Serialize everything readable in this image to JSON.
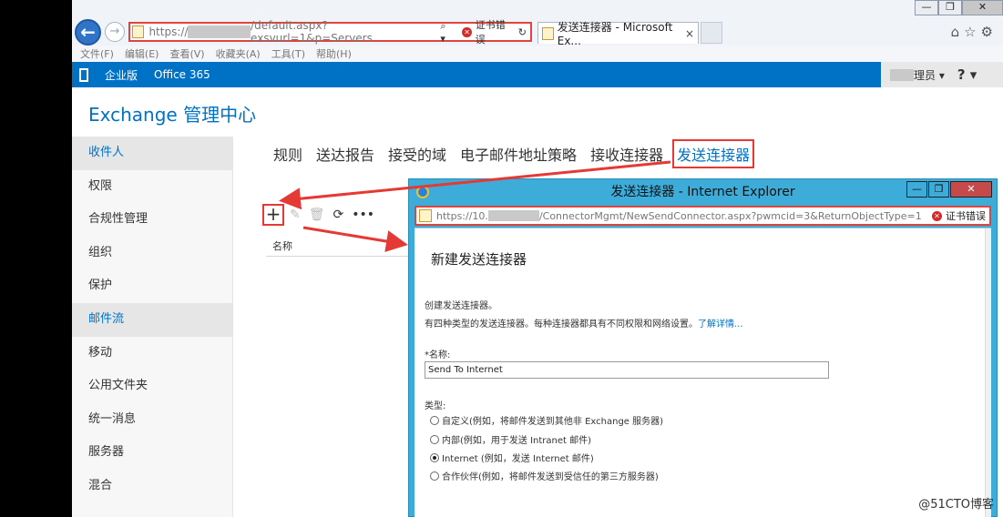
{
  "browser": {
    "url_prefix": "https://",
    "url_suffix": "/default.aspx?exsvurl=1&p=Servers",
    "search_glyph": "⌕ ▾",
    "cert_error": "证书错误",
    "refresh_glyph": "↻",
    "tab_title": "发送连接器 - Microsoft Ex...",
    "tab_close": "×",
    "win_min": "—",
    "win_max": "❐",
    "win_close": "✕",
    "icons": "⌂☆⚙",
    "menu": [
      "文件(F)",
      "编辑(E)",
      "查看(V)",
      "收藏夹(A)",
      "工具(T)",
      "帮助(H)"
    ]
  },
  "office": {
    "edition": "企业版",
    "product": "Office 365",
    "user_suffix": "理员 ▾",
    "help": "? ▾"
  },
  "app_title": "Exchange 管理中心",
  "nav": [
    {
      "label": "收件人",
      "selected": true
    },
    {
      "label": "权限",
      "selected": false
    },
    {
      "label": "合规性管理",
      "selected": false
    },
    {
      "label": "组织",
      "selected": false
    },
    {
      "label": "保护",
      "selected": false
    },
    {
      "label": "邮件流",
      "selected": true
    },
    {
      "label": "移动",
      "selected": false
    },
    {
      "label": "公用文件夹",
      "selected": false
    },
    {
      "label": "统一消息",
      "selected": false
    },
    {
      "label": "服务器",
      "selected": false
    },
    {
      "label": "混合",
      "selected": false
    }
  ],
  "tabs": [
    "规则",
    "送达报告",
    "接受的域",
    "电子邮件地址策略",
    "接收连接器",
    "发送连接器"
  ],
  "toolbar": {
    "add": "+",
    "edit": "✎",
    "delete": "🗑",
    "refresh": "⟳",
    "more": "•••"
  },
  "column_name": "名称",
  "popup": {
    "title": "发送连接器 - Internet Explorer",
    "url_prefix": "https://10.",
    "url_suffix": "/ConnectorMgmt/NewSendConnector.aspx?pwmcid=3&ReturnObjectType=1",
    "cert_error": "证书错误",
    "heading": "新建发送连接器",
    "desc1": "创建发送连接器。",
    "desc2": "有四种类型的发送连接器。每种连接器都具有不同权限和网络设置。",
    "learn_more": "了解详情...",
    "name_label": "*名称:",
    "name_value": "Send To Internet",
    "type_label": "类型:",
    "types": [
      {
        "label": "自定义(例如，将邮件发送到其他非 Exchange 服务器)",
        "checked": false
      },
      {
        "label": "内部(例如，用于发送 Intranet 邮件)",
        "checked": false
      },
      {
        "label": "Internet (例如，发送 Internet 邮件)",
        "checked": true
      },
      {
        "label": "合作伙伴(例如，将邮件发送到受信任的第三方服务器)",
        "checked": false
      }
    ]
  },
  "watermark": "@51CTO博客",
  "colors": {
    "accent": "#0072c6",
    "highlight": "#e53935",
    "popup_frame": "#3dacd9"
  }
}
